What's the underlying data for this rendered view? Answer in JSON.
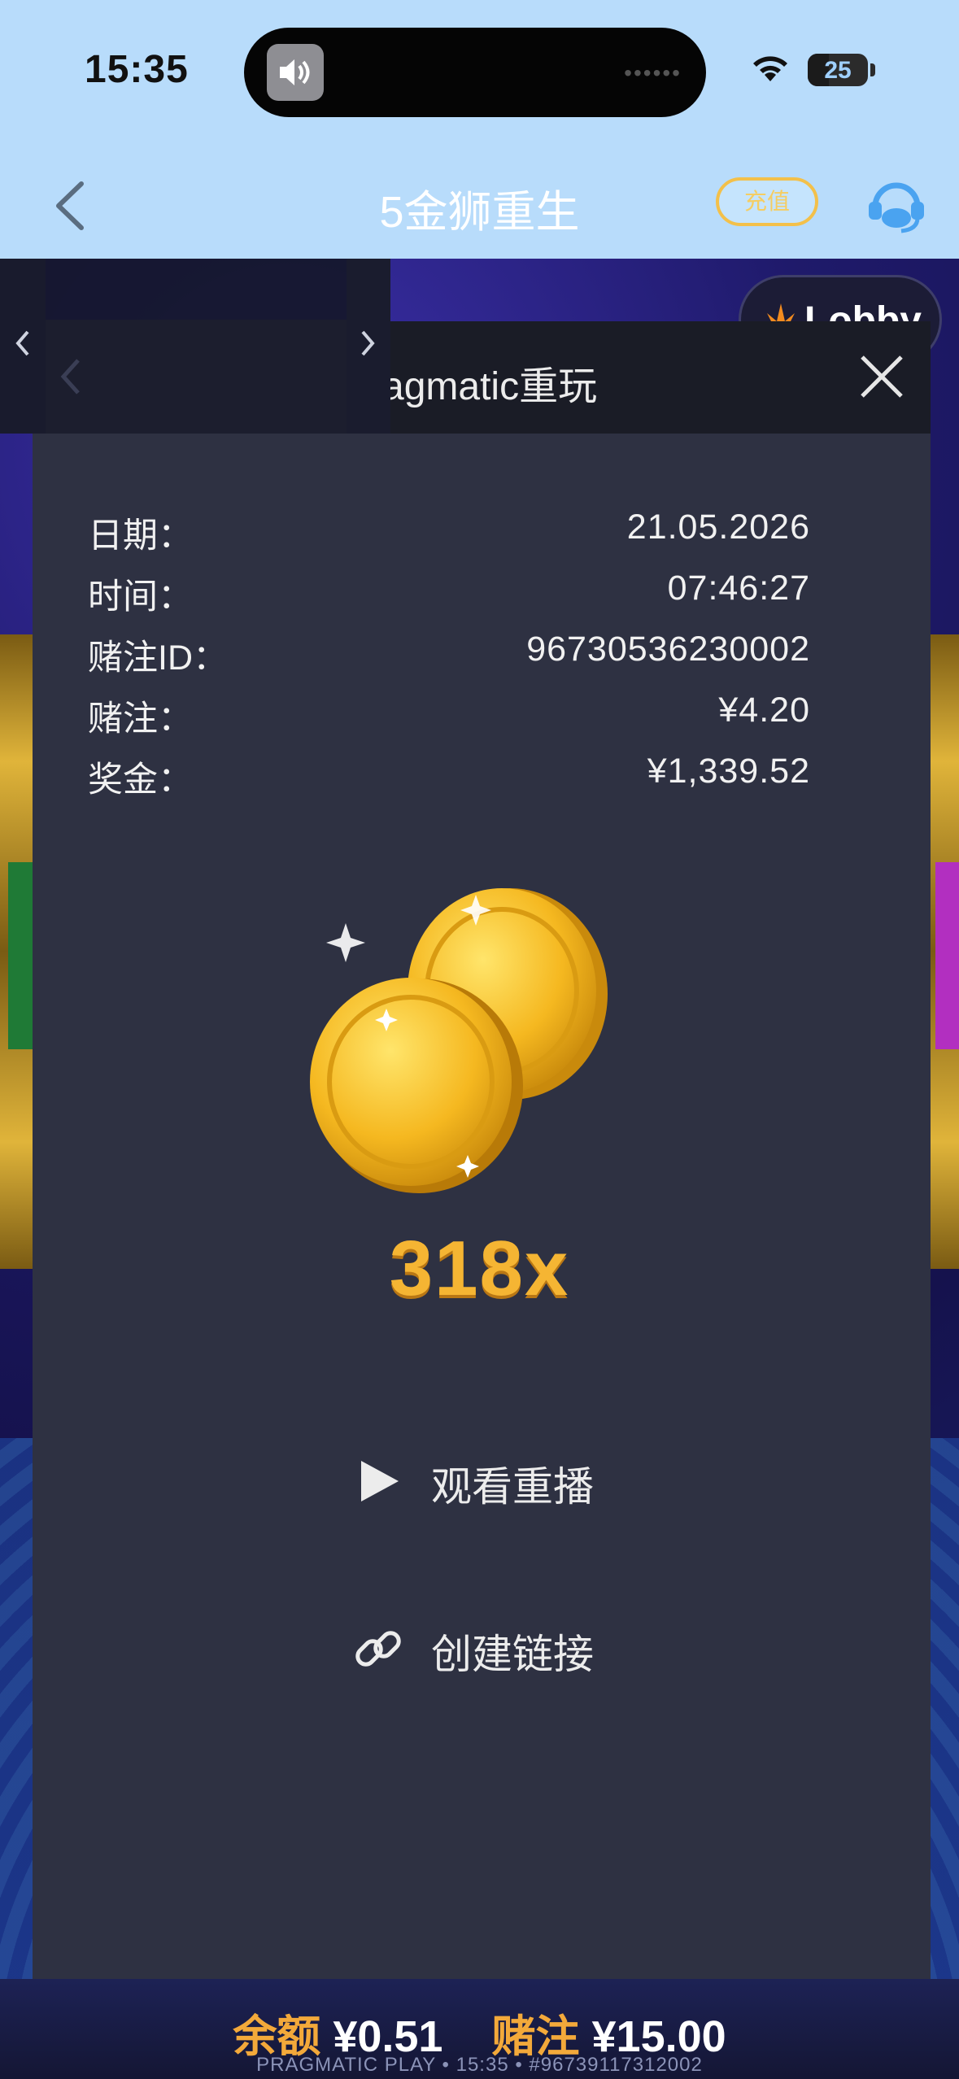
{
  "status": {
    "time": "15:35",
    "battery": "25"
  },
  "nav": {
    "title": "5金狮重生",
    "recharge_label": "充值"
  },
  "game": {
    "lobby_label": "Lobby"
  },
  "replay": {
    "title": "agmatic重玩",
    "details": [
      {
        "label": "日期：",
        "value": "21.05.2026"
      },
      {
        "label": "时间：",
        "value": "07:46:27"
      },
      {
        "label": "赌注ID：",
        "value": "96730536230002"
      },
      {
        "label": "赌注：",
        "value": "¥4.20"
      },
      {
        "label": "奖金：",
        "value": "¥1,339.52"
      }
    ],
    "multiplier": "318x",
    "watch_replay_label": "观看重播",
    "create_link_label": "创建链接"
  },
  "footer": {
    "balance_label": "余额",
    "balance_value": "¥0.51",
    "bet_label": "赌注",
    "bet_value": "¥15.00",
    "info": "PRAGMATIC PLAY • 15:35 • #96739117312002"
  }
}
